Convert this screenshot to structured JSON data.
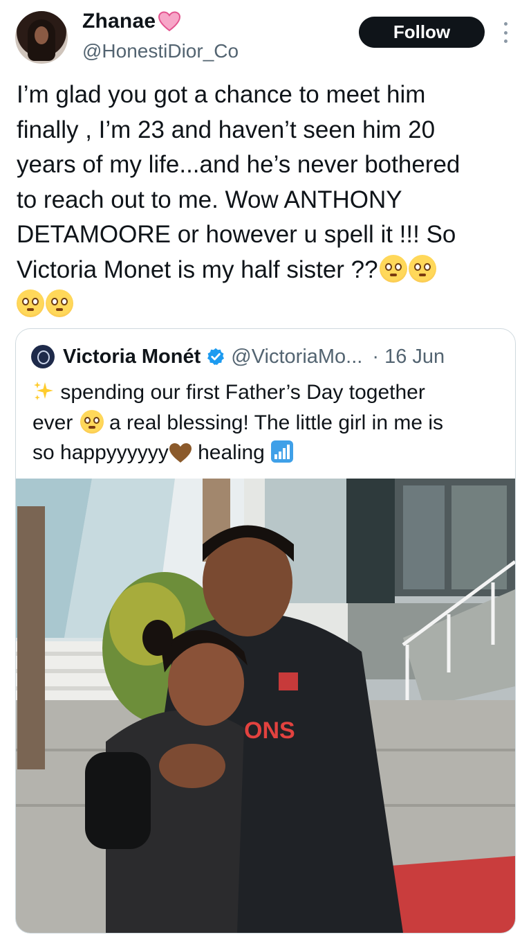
{
  "author": {
    "display_name": "Zhanae",
    "handle": "@HonestiDior_Co",
    "name_emoji": "pink-heart"
  },
  "actions": {
    "follow_label": "Follow"
  },
  "tweet": {
    "lines": [
      "I’m glad you got a chance to meet him",
      "finally , I’m 23 and haven’t seen him 20",
      "years of my life...and he’s never bothered",
      "to reach out to me. Wow ANTHONY",
      "DETAMOORE or however u spell it !!! So",
      "Victoria Monet is my half sister ??"
    ]
  },
  "quoted": {
    "display_name": "Victoria Monét",
    "handle": "@VictoriaMo...",
    "date": "· 16 Jun",
    "line1": " spending our first Father’s Day together",
    "line2_a": "ever ",
    "line2_b": " a real blessing! The little girl in me is",
    "line3_a": "so happyyyyyy",
    "line3_b": "  healing"
  },
  "colors": {
    "follow_bg": "#0f1419",
    "secondary_text": "#536471",
    "verified": "#1d9bf0",
    "border": "#cfd9de"
  }
}
